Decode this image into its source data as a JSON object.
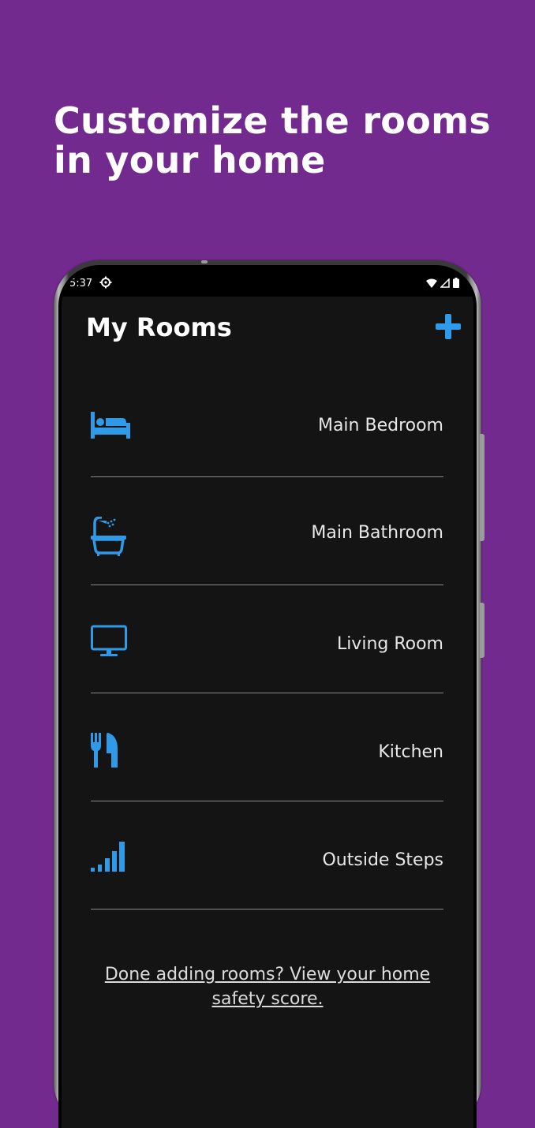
{
  "headline": {
    "line1": "Customize the rooms",
    "line2": "in your home"
  },
  "status_bar": {
    "time": "5:37"
  },
  "app_bar": {
    "title": "My Rooms",
    "add_icon": "plus-icon"
  },
  "rooms": [
    {
      "label": "Main Bedroom",
      "icon": "bed-icon"
    },
    {
      "label": "Main Bathroom",
      "icon": "bathtub-icon"
    },
    {
      "label": "Living Room",
      "icon": "tv-icon"
    },
    {
      "label": "Kitchen",
      "icon": "utensils-icon"
    },
    {
      "label": "Outside Steps",
      "icon": "steps-icon"
    }
  ],
  "footer": {
    "link_text": "Done adding rooms? View your home safety score."
  },
  "colors": {
    "background": "#722a8e",
    "accent": "#2f9ae8",
    "screen": "#141414"
  }
}
